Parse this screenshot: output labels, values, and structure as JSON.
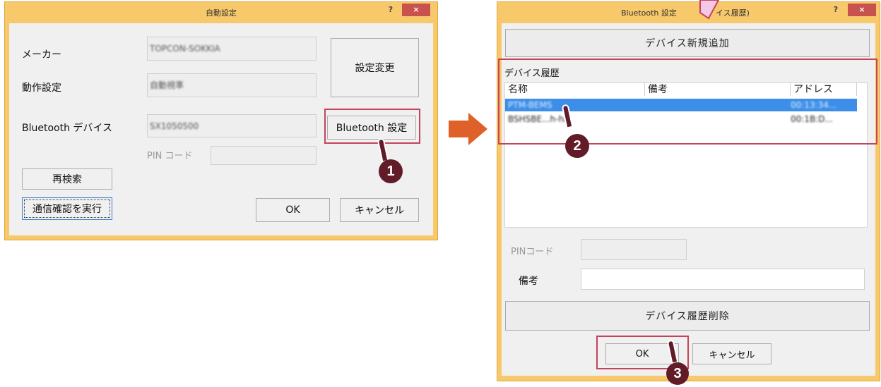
{
  "left_dialog": {
    "title": "自動設定",
    "help_label": "?",
    "close_label": "×",
    "maker_label": "メーカー",
    "maker_value": "TOPCON-SOKKIA",
    "operation_label": "動作設定",
    "operation_value": "自動視準",
    "settings_change_button": "設定変更",
    "bluetooth_device_label": "Bluetooth デバイス",
    "bluetooth_device_value": "SX1050500",
    "bluetooth_settings_button": "Bluetooth 設定",
    "pin_label": "PIN コード",
    "pin_value": "",
    "research_button": "再検索",
    "comm_check_button": "通信確認を実行",
    "ok_button": "OK",
    "cancel_button": "キャンセル"
  },
  "right_dialog": {
    "title_left": "Bluetooth 設定",
    "title_right": "イス履歴)",
    "help_label": "?",
    "close_label": "×",
    "add_device_button": "デバイス新規追加",
    "history_label": "デバイス履歴",
    "columns": [
      "名称",
      "備考",
      "アドレス"
    ],
    "rows": [
      {
        "name": "PTM-BEMS",
        "note": "",
        "address": "00:13:34..."
      },
      {
        "name": "BSHSBE...h-ha",
        "note": "",
        "address": "00:1B:D..."
      }
    ],
    "pin_label": "PINコード",
    "pin_value": "",
    "note_label": "備考",
    "note_value": "",
    "delete_history_button": "デバイス履歴削除",
    "ok_button": "OK",
    "cancel_button": "キャンセル"
  },
  "markers": {
    "step1": "1",
    "step2": "2",
    "step3": "3"
  },
  "colors": {
    "frame": "#f8c96a",
    "highlight": "#c4445c",
    "marker": "#611c28",
    "arrow": "#e0602a",
    "selection": "#3c8ee8"
  }
}
